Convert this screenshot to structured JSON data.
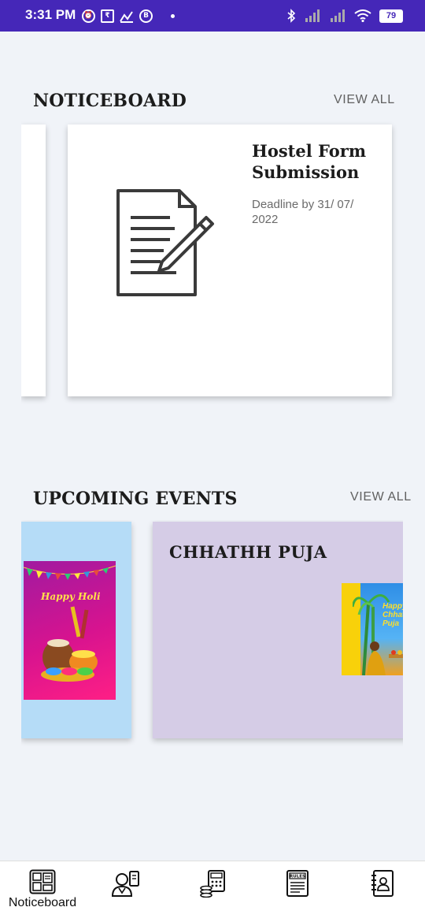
{
  "status_bar": {
    "time": "3:31 PM",
    "left_icons": [
      "alarm-icon",
      "rupee-icon",
      "stocks-icon",
      "b-icon"
    ],
    "right_icons": [
      "bluetooth-icon",
      "signal-icon",
      "signal-icon",
      "wifi-icon"
    ],
    "battery": "79"
  },
  "noticeboard": {
    "title": "NOTICEBOARD",
    "view_all": "VIEW ALL",
    "card": {
      "title": "Hostel Form Submission",
      "subtitle": "Deadline by 31/ 07/ 2022",
      "icon": "document-edit-icon"
    }
  },
  "events": {
    "title": "UPCOMING EVENTS",
    "view_all": "VIEW ALL",
    "peek_card": {
      "image_text": "Happy Holi",
      "bg_color": "#b5dcf7"
    },
    "card": {
      "title": "CHHATHH PUJA",
      "bg_color": "#d5cce6",
      "image_text": "Happy Chhath Puja"
    }
  },
  "bottom_nav": {
    "items": [
      {
        "label": "Noticeboard",
        "icon": "noticeboard-icon",
        "active": true
      },
      {
        "label": "",
        "icon": "profile-icon",
        "active": false
      },
      {
        "label": "",
        "icon": "accounts-icon",
        "active": false
      },
      {
        "label": "",
        "icon": "rules-icon",
        "active": false
      },
      {
        "label": "",
        "icon": "contacts-icon",
        "active": false
      }
    ],
    "rules_icon_text": "RULES"
  },
  "colors": {
    "status_bar": "#4527b8",
    "background": "#f0f3f8"
  }
}
